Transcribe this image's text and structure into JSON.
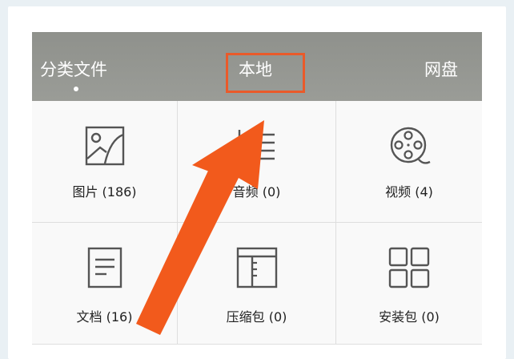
{
  "tabs": [
    {
      "label": "分类文件",
      "active": true
    },
    {
      "label": "本地",
      "highlighted": true
    },
    {
      "label": "网盘"
    }
  ],
  "categories": [
    {
      "label": "图片 (186)",
      "icon": "image-icon"
    },
    {
      "label": "音频 (0)",
      "icon": "music-list-icon"
    },
    {
      "label": "视频 (4)",
      "icon": "film-reel-icon"
    },
    {
      "label": "文档 (16)",
      "icon": "document-icon"
    },
    {
      "label": "压缩包 (0)",
      "icon": "archive-icon"
    },
    {
      "label": "安装包 (0)",
      "icon": "grid-apps-icon"
    }
  ],
  "colors": {
    "tabbar": "#999b96",
    "highlight": "#ea5a2a",
    "arrow": "#f25a1c",
    "icon": "#555555"
  }
}
